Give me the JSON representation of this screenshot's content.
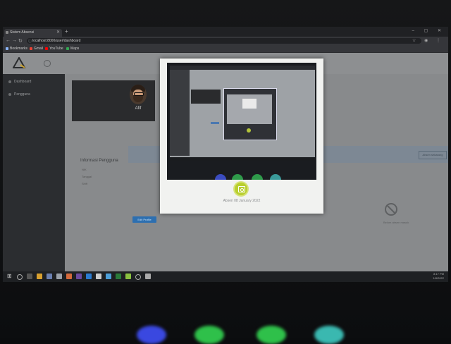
{
  "browser": {
    "tab_title": "Sistem Absensi",
    "url": "localhost:8000/user/dashboard",
    "bookmarks": [
      "Bookmarks",
      "Gmail",
      "YouTube",
      "Maps"
    ]
  },
  "sidebar": {
    "items": [
      {
        "label": "Dashboard"
      },
      {
        "label": "Pengguna"
      }
    ]
  },
  "profile": {
    "name": "Afif"
  },
  "info": {
    "title": "Informasi Pengguna",
    "fields": [
      "NIK",
      "Tanggal",
      "Shift"
    ]
  },
  "buttons": {
    "edit_profile": "Edit Profile",
    "right_action": "Absen sekarang"
  },
  "empty_state": {
    "text": "Belum absen masuk"
  },
  "viewer": {
    "caption": "Absen 08 January 2022"
  },
  "taskbar": {
    "time": "8:17 PM",
    "date": "1/8/2022"
  },
  "colors": {
    "accent_green": "#b9cf2f",
    "button_blue": "#2d6fb0"
  }
}
